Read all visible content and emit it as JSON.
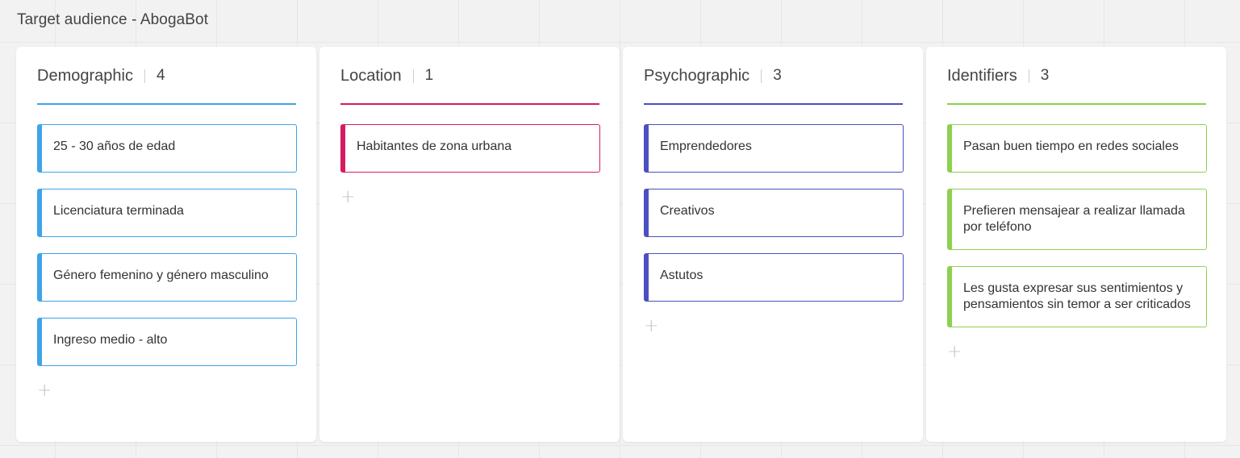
{
  "board": {
    "title": "Target audience - AbogaBot"
  },
  "columns": [
    {
      "name": "Demographic",
      "count": "4",
      "color": "#3da4ea",
      "cards": [
        "25 - 30 años de edad",
        "Licenciatura terminada",
        "Género femenino y género masculino",
        "Ingreso medio - alto"
      ],
      "add_label": "+"
    },
    {
      "name": "Location",
      "count": "1",
      "color": "#d81b60",
      "cards": [
        "Habitantes de zona urbana"
      ],
      "add_label": "+"
    },
    {
      "name": "Psychographic",
      "count": "3",
      "color": "#4c4fc0",
      "cards": [
        "Emprendedores",
        "Creativos",
        "Astutos"
      ],
      "add_label": "+"
    },
    {
      "name": "Identifiers",
      "count": "3",
      "color": "#8bd150",
      "cards": [
        "Pasan buen tiempo en redes sociales",
        "Prefieren mensajear a realizar llamada por teléfono",
        "Les gusta expresar sus sentimientos y pensamientos sin temor a ser criticados"
      ],
      "add_label": "+"
    }
  ]
}
